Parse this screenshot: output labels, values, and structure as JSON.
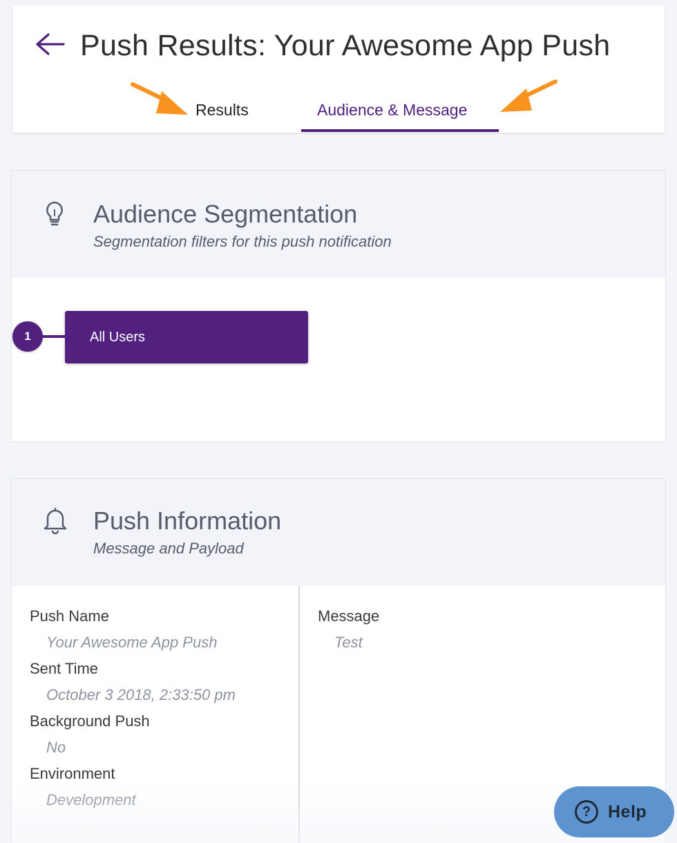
{
  "header": {
    "title": "Push Results: Your Awesome App Push",
    "tabs": [
      {
        "label": "Results",
        "active": false
      },
      {
        "label": "Audience & Message",
        "active": true
      }
    ]
  },
  "segmentation": {
    "title": "Audience Segmentation",
    "subtitle": "Segmentation filters for this push notification",
    "icon": "lightbulb-icon",
    "steps": [
      {
        "number": "1",
        "label": "All Users"
      }
    ]
  },
  "push_info": {
    "title": "Push Information",
    "subtitle": "Message and Payload",
    "icon": "bell-icon",
    "left_fields": [
      {
        "label": "Push Name",
        "value": "Your Awesome App Push"
      },
      {
        "label": "Sent Time",
        "value": "October 3 2018, 2:33:50 pm"
      },
      {
        "label": "Background Push",
        "value": "No"
      },
      {
        "label": "Environment",
        "value": "Development"
      }
    ],
    "right_fields": [
      {
        "label": "Message",
        "value": "Test"
      }
    ]
  },
  "help": {
    "label": "Help",
    "icon": "question-icon"
  },
  "colors": {
    "brand_purple": "#52217f",
    "annotation_orange": "#f7931e",
    "help_blue": "#5d93cf"
  }
}
